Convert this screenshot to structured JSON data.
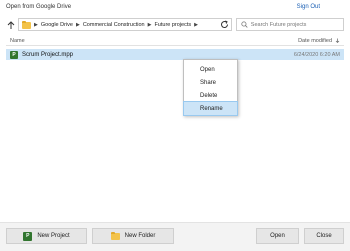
{
  "window": {
    "title": "Open from Google Drive",
    "sign_out": "Sign Out"
  },
  "toolbar": {
    "up_icon": "arrow-up-icon",
    "breadcrumb": [
      "Google Drive",
      "Commercial Construction",
      "Future projects"
    ],
    "breadcrumb_separator": "▶",
    "refresh_icon": "refresh-icon",
    "search_placeholder": "Search Future projects"
  },
  "list": {
    "columns": {
      "name": "Name",
      "date_modified": "Date modified"
    },
    "files": [
      {
        "name": "Scrum Project.mpp",
        "date": "6/24/2020 6:20 AM",
        "icon": "project-file-icon",
        "selected": true
      }
    ]
  },
  "context_menu": {
    "items": [
      "Open",
      "Share",
      "Delete",
      "Rename"
    ],
    "highlighted": "Rename"
  },
  "footer": {
    "new_project": "New Project",
    "new_folder": "New Folder",
    "open": "Open",
    "close": "Close"
  },
  "colors": {
    "selection": "#cce4f7",
    "link": "#1a5fb4",
    "project_green": "#31752f",
    "folder_yellow": "#f3c34a"
  }
}
